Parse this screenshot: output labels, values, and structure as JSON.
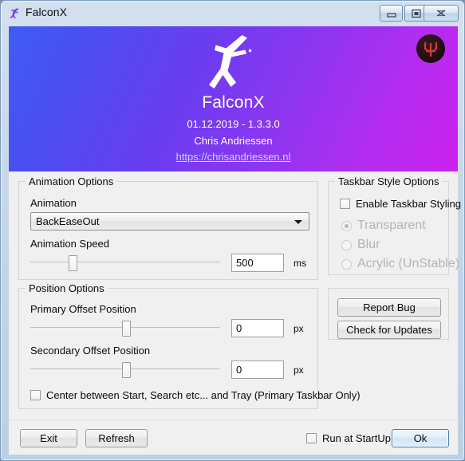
{
  "window": {
    "title": "FalconX",
    "icon": "falcon-f-icon",
    "buttons": {
      "minimize": "minimize-icon",
      "maximize": "maximize-icon",
      "close": "close-icon"
    }
  },
  "banner": {
    "logo": "falconx-brush-f-logo",
    "title": "FalconX",
    "version": "01.12.2019 - 1.3.3.0",
    "author": "Chris Andriessen",
    "link": "https://chrisandriessen.nl",
    "badge": "circular-red-emblem",
    "gradient_from": "#3f5cf4",
    "gradient_to": "#cc22ee"
  },
  "animation_options": {
    "title": "Animation Options",
    "animation_label": "Animation",
    "animation_value": "BackEaseOut",
    "speed_label": "Animation Speed",
    "speed_value": "500",
    "speed_unit": "ms",
    "speed_slider_percent": 22
  },
  "position_options": {
    "title": "Position Options",
    "primary_label": "Primary Offset Position",
    "primary_value": "0",
    "primary_unit": "px",
    "primary_slider_percent": 50,
    "secondary_label": "Secondary Offset Position",
    "secondary_value": "0",
    "secondary_unit": "px",
    "secondary_slider_percent": 50,
    "center_checkbox_label": "Center between Start, Search etc... and Tray (Primary Taskbar Only)"
  },
  "taskbar_style_options": {
    "title": "Taskbar Style Options",
    "enable_label": "Enable Taskbar Styling",
    "options": [
      {
        "label": "Transparent",
        "selected": true
      },
      {
        "label": "Blur",
        "selected": false
      },
      {
        "label": "Acrylic (UnStable)",
        "selected": false
      }
    ]
  },
  "actions": {
    "report_bug": "Report Bug",
    "check_updates": "Check for Updates"
  },
  "footer": {
    "exit": "Exit",
    "refresh": "Refresh",
    "run_at_startup_label": "Run at StartUp",
    "ok": "Ok",
    "default_button_accent": "#3c7fb1"
  }
}
